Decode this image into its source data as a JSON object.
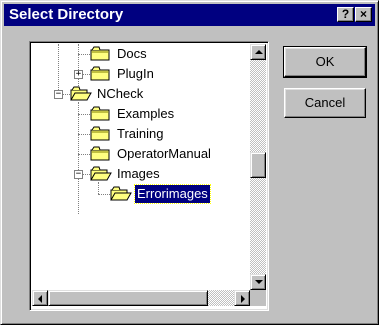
{
  "window": {
    "title": "Select Directory",
    "help_label": "?",
    "close_label": "×"
  },
  "tree": {
    "nodes": [
      {
        "label": "Docs",
        "expander": null
      },
      {
        "label": "PlugIn",
        "expander": "+"
      },
      {
        "label": "NCheck",
        "expander": "−"
      },
      {
        "label": "Examples",
        "expander": null
      },
      {
        "label": "Training",
        "expander": null
      },
      {
        "label": "OperatorManual",
        "expander": null
      },
      {
        "label": "Images",
        "expander": "−"
      },
      {
        "label": "Errorimages",
        "expander": null,
        "selected": true
      }
    ]
  },
  "buttons": {
    "ok_label": "OK",
    "cancel_label": "Cancel"
  },
  "colors": {
    "titlebar": "#000080",
    "face": "#c0c0c0",
    "selection": "#000080",
    "folder": "#ffff80"
  },
  "icons": {
    "folder": "folder-icon",
    "scroll_up": "arrow-up-icon",
    "scroll_down": "arrow-down-icon",
    "scroll_left": "arrow-left-icon",
    "scroll_right": "arrow-right-icon"
  }
}
